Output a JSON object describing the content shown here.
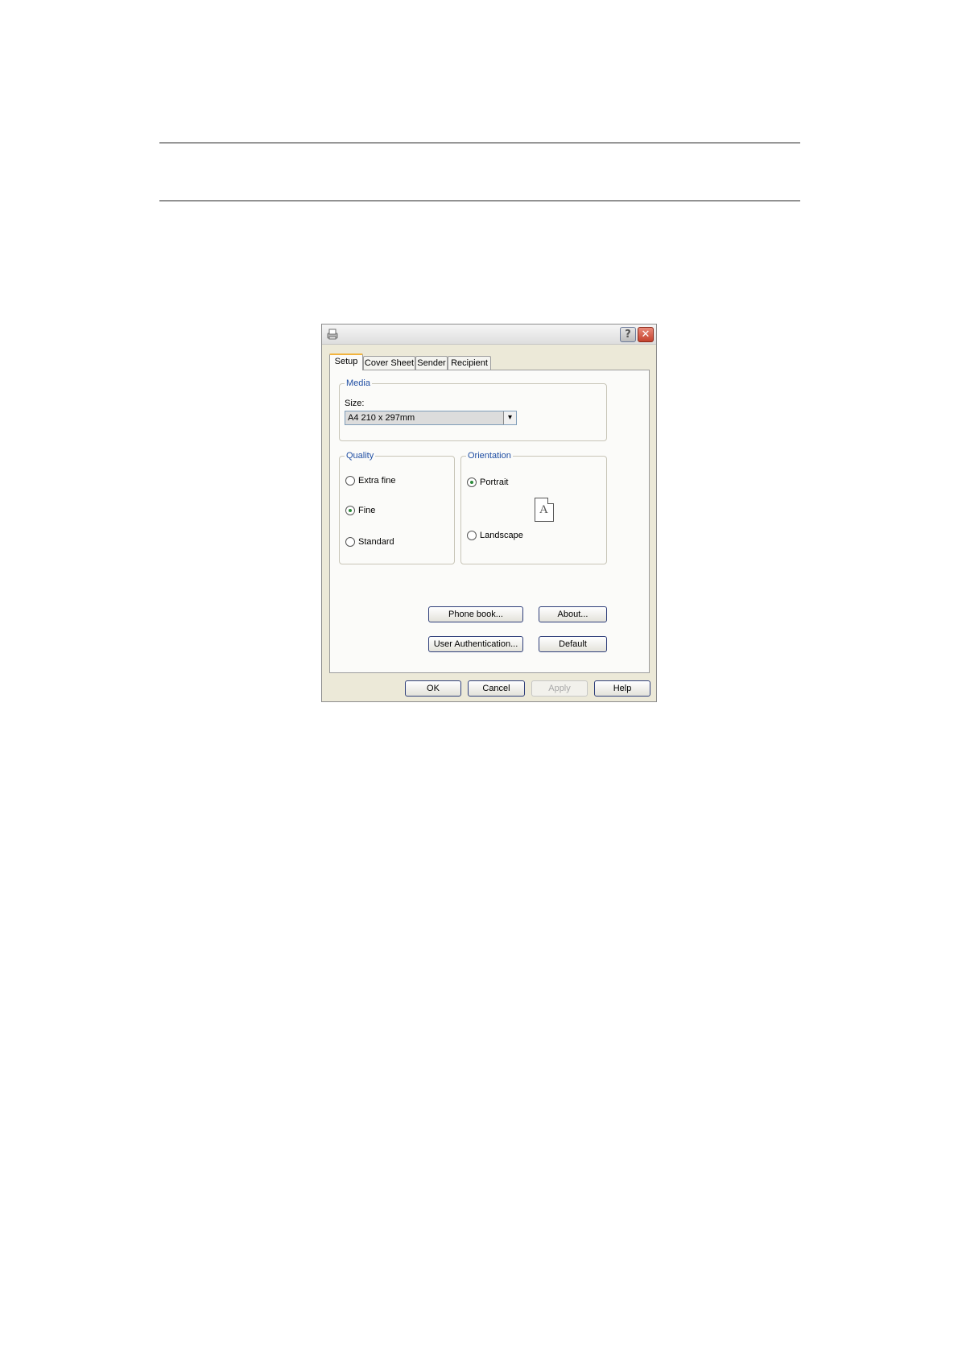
{
  "tabs": [
    "Setup",
    "Cover Sheet",
    "Sender",
    "Recipient"
  ],
  "media": {
    "title": "Media",
    "size_label": "Size:",
    "size_value": "A4 210 x 297mm"
  },
  "quality": {
    "title": "Quality",
    "options": [
      "Extra fine",
      "Fine",
      "Standard"
    ],
    "selected": "Fine"
  },
  "orientation": {
    "title": "Orientation",
    "options": [
      "Portrait",
      "Landscape"
    ],
    "selected": "Portrait",
    "preview_letter": "A"
  },
  "panel_buttons": {
    "phone_book": "Phone book...",
    "about": "About...",
    "user_authentication": "User Authentication...",
    "default": "Default"
  },
  "dialog_buttons": {
    "ok": "OK",
    "cancel": "Cancel",
    "apply": "Apply",
    "help": "Help"
  },
  "titlebar": {
    "help_glyph": "?",
    "close_glyph": "✕"
  },
  "select_arrow_glyph": "▾"
}
